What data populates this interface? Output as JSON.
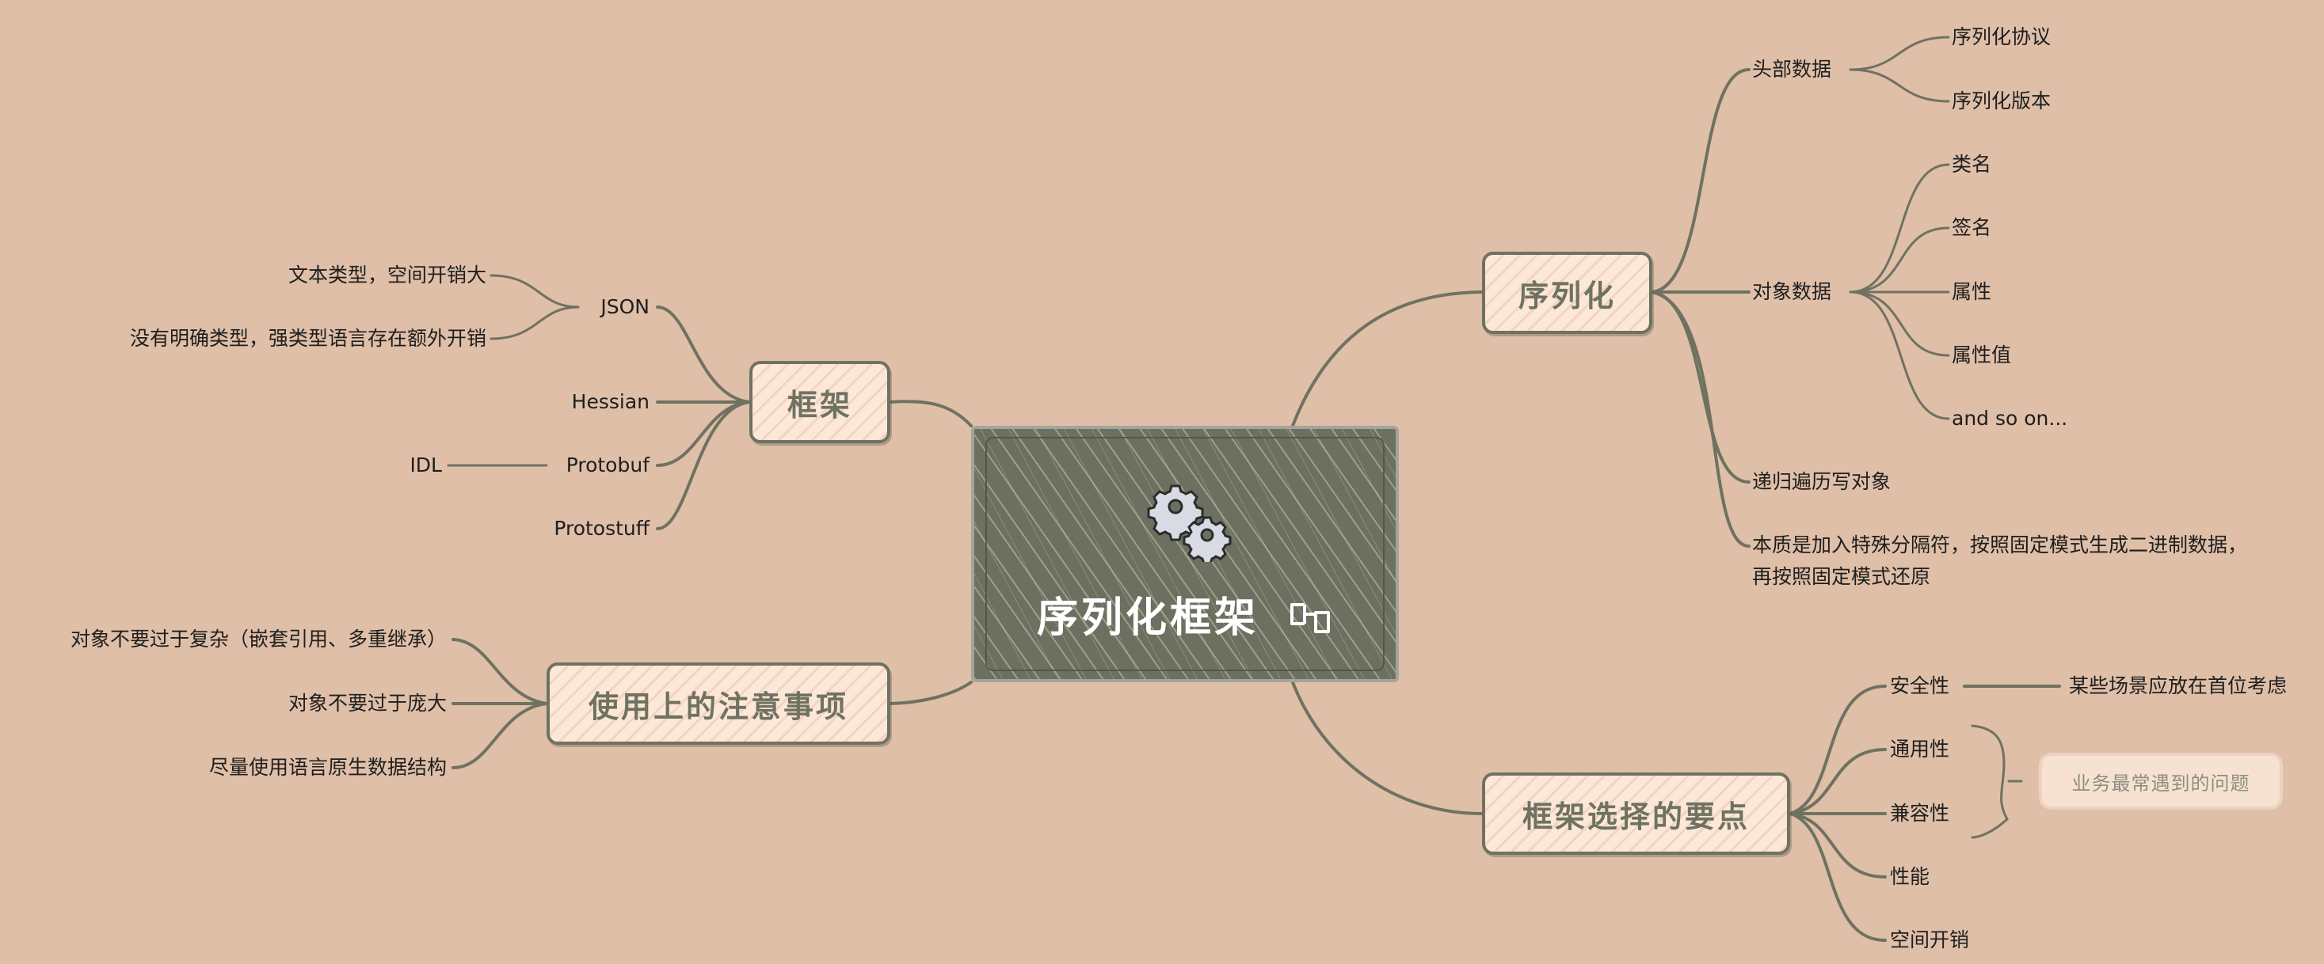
{
  "central": {
    "title": "序列化框架",
    "icons": [
      "gears-icon",
      "link-icon"
    ]
  },
  "branches": {
    "serialization": {
      "label": "序列化",
      "header_data": {
        "label": "头部数据",
        "items": [
          "序列化协议",
          "序列化版本"
        ]
      },
      "object_data": {
        "label": "对象数据",
        "items": [
          "类名",
          "签名",
          "属性",
          "属性值",
          "and so on..."
        ]
      },
      "recursive": "递归遍历写对象",
      "essence": "本质是加入特殊分隔符，按照固定模式生成二进制数据，再按照固定模式还原"
    },
    "frameworks": {
      "label": "框架",
      "json": {
        "label": "JSON",
        "items": [
          "文本类型，空间开销大",
          "没有明确类型，强类型语言存在额外开销"
        ]
      },
      "hessian": "Hessian",
      "protobuf": {
        "label": "Protobuf",
        "items": [
          "IDL"
        ]
      },
      "protostuff": "Protostuff"
    },
    "usage_notes": {
      "label": "使用上的注意事项",
      "items": [
        "对象不要过于复杂（嵌套引用、多重继承）",
        "对象不要过于庞大",
        "尽量使用语言原生数据结构"
      ]
    },
    "selection_points": {
      "label": "框架选择的要点",
      "security": {
        "label": "安全性",
        "items": [
          "某些场景应放在首位考虑"
        ]
      },
      "items": [
        "通用性",
        "兼容性",
        "性能",
        "空间开销"
      ],
      "bracket_note": "业务最常遇到的问题"
    }
  },
  "colors": {
    "background": "#dfbfa8",
    "line": "#6f7261",
    "central_fill": "#6b7060",
    "branch_fill": "#fde7d6",
    "branch_text": "#6f7261"
  }
}
